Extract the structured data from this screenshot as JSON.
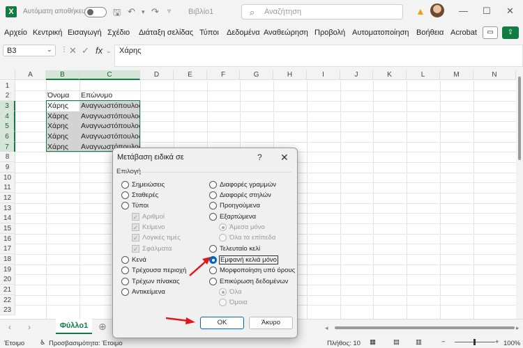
{
  "titlebar": {
    "app_logo": "X",
    "autosave_label": "Αυτόματη αποθήκευση",
    "document_title": "Βιβλίο1",
    "search_placeholder": "Αναζήτηση"
  },
  "menu": [
    "Αρχείο",
    "Κεντρική",
    "Εισαγωγή",
    "Σχέδιο",
    "Διάταξη σελίδας",
    "Τύποι",
    "Δεδομένα",
    "Αναθεώρηση",
    "Προβολή",
    "Αυτοματοποίηση",
    "Βοήθεια",
    "Acrobat"
  ],
  "formula_bar": {
    "name_box": "B3",
    "fx": "fx",
    "content": "Χάρης"
  },
  "columns": [
    "A",
    "B",
    "C",
    "D",
    "E",
    "F",
    "G",
    "H",
    "I",
    "J",
    "K",
    "L",
    "M",
    "N"
  ],
  "rows": [
    "1",
    "2",
    "3",
    "4",
    "5",
    "6",
    "7",
    "8",
    "9",
    "10",
    "11",
    "12",
    "13",
    "14",
    "15",
    "16",
    "17",
    "18",
    "19",
    "20",
    "21",
    "22",
    "23"
  ],
  "cells": {
    "b2": "Όνομα",
    "c2": "Επώνυμο",
    "b3": "Χάρης",
    "c3": "Αναγνωστόπουλος",
    "b4": "Χάρης",
    "c4": "Αναγνωστόπουλος",
    "b5": "Χάρης",
    "c5": "Αναγνωστόπουλος",
    "b6": "Χάρης",
    "c6": "Αναγνωστόπουλος",
    "b7": "Χάρης",
    "c7": "Αναγνωστόπουλος"
  },
  "sheet_tab": "Φύλλο1",
  "status": {
    "ready": "Έτοιμο",
    "accessibility": "Προσβασιμότητα: Έτοιμο",
    "count": "Πλήθος: 10",
    "zoom": "100%"
  },
  "dialog": {
    "title": "Μετάβαση ειδικά σε",
    "help": "?",
    "group_label": "Επιλογή",
    "left_options": [
      "Σημειώσεις",
      "Σταθερές",
      "Τύποι"
    ],
    "formula_checks": [
      "Αριθμοί",
      "Κείμενο",
      "Λογικές τιμές",
      "Σφάλματα"
    ],
    "left_options_2": [
      "Κενά",
      "Τρέχουσα περιοχή",
      "Τρέχων πίνακας",
      "Αντικείμενα"
    ],
    "right_options": [
      "Διαφορές γραμμών",
      "Διαφορές στηλών",
      "Προηγούμενα",
      "Εξαρτώμενα"
    ],
    "dependents_sub": [
      "Άμεσα μόνο",
      "Όλα τα επίπεδα"
    ],
    "right_options_2": [
      "Τελευταίο κελί",
      "Εμφανή κελιά μόνο",
      "Μορφοποίηση υπό όρους",
      "Επικύρωση δεδομένων"
    ],
    "validation_sub": [
      "Όλα",
      "Όμοια"
    ],
    "selected": "Εμφανή κελιά μόνο",
    "ok_label": "ΟΚ",
    "cancel_label": "Άκυρο"
  },
  "colors": {
    "excel_green": "#107c41",
    "accent_blue": "#0067c0",
    "annotation_red": "#e0181b"
  }
}
